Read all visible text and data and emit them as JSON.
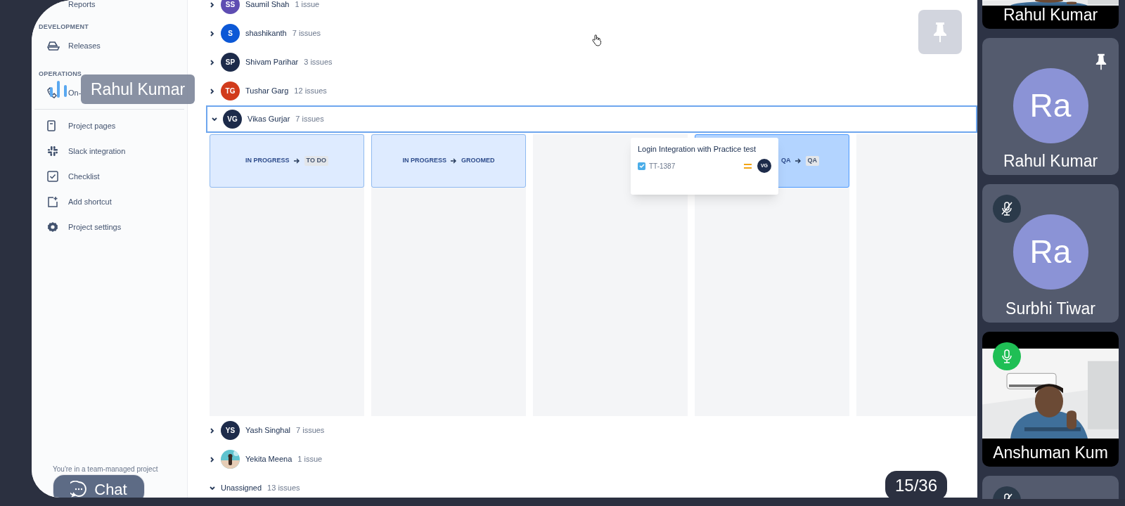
{
  "sidebar": {
    "items": [
      {
        "kind": "link",
        "label": "Reports"
      },
      {
        "kind": "section",
        "label": "DEVELOPMENT"
      },
      {
        "kind": "link",
        "label": "Releases"
      },
      {
        "kind": "section",
        "label": "OPERATIONS"
      },
      {
        "kind": "link",
        "label": "On-"
      },
      {
        "kind": "divider"
      },
      {
        "kind": "link",
        "label": "Project pages"
      },
      {
        "kind": "link",
        "label": "Slack integration"
      },
      {
        "kind": "link",
        "label": "Checklist"
      },
      {
        "kind": "link",
        "label": "Add shortcut"
      },
      {
        "kind": "link",
        "label": "Project settings"
      }
    ],
    "footer": "You're in a team-managed project"
  },
  "speaker_label": {
    "name": "Rahul Kumar"
  },
  "groups": [
    {
      "kind": "initials",
      "initials": "SS",
      "color": "#5e4db2",
      "name": "Saumil Shah",
      "count": "1 issue",
      "expanded": false
    },
    {
      "kind": "initials",
      "initials": "S",
      "color": "#0c58d6",
      "name": "shashikanth",
      "count": "7 issues",
      "expanded": false
    },
    {
      "kind": "initials",
      "initials": "SP",
      "color": "#1d2b4a",
      "name": "Shivam Parihar",
      "count": "3 issues",
      "expanded": false
    },
    {
      "kind": "initials",
      "initials": "TG",
      "color": "#d13b1c",
      "name": "Tushar Garg",
      "count": "12 issues",
      "expanded": false
    },
    {
      "kind": "initials",
      "initials": "VG",
      "color": "#1d2b4a",
      "name": "Vikas Gurjar",
      "count": "7 issues",
      "expanded": true,
      "columns": [
        {
          "kind": "transition",
          "from": "IN PROGRESS",
          "to": "TO DO",
          "to_lozenge": true,
          "active": false
        },
        {
          "kind": "transition",
          "from": "IN PROGRESS",
          "to": "GROOMED",
          "to_lozenge": false,
          "active": false
        },
        {
          "kind": "empty"
        },
        {
          "kind": "transition",
          "from": "QA",
          "to": "QA",
          "to_lozenge": true,
          "active": true
        },
        {
          "kind": "empty"
        }
      ]
    },
    {
      "kind": "initials",
      "initials": "YS",
      "color": "#1d2b4a",
      "name": "Yash Singhal",
      "count": "7 issues",
      "expanded": false
    },
    {
      "name": "Yekita Meena",
      "count": "1 issue",
      "expanded": false
    },
    {
      "kind": "plain",
      "name": "Unassigned",
      "count": "13 issues",
      "expanded": true
    }
  ],
  "dragged_card": {
    "title": "Login Integration with Practice test",
    "key": "TT-1387",
    "assignee": "VG"
  },
  "chat_button": {
    "label": "Chat"
  },
  "page_counter": "15/36",
  "participants": [
    {
      "kind": "video",
      "name": "Rahul Kumar",
      "pinned": false
    },
    {
      "kind": "avatar",
      "initials": "Ra",
      "name": "Rahul Kumar",
      "pinned": true
    },
    {
      "kind": "avatar",
      "initials": "Ra",
      "name": "Surbhi Tiwar",
      "mic": {
        "muted": true
      },
      "pinned": false
    },
    {
      "kind": "video",
      "name": "Anshuman Kum",
      "mic": {
        "muted": false
      },
      "pinned": false
    },
    {
      "kind": "avatar",
      "mic": {
        "muted": true
      },
      "pinned": false
    }
  ]
}
